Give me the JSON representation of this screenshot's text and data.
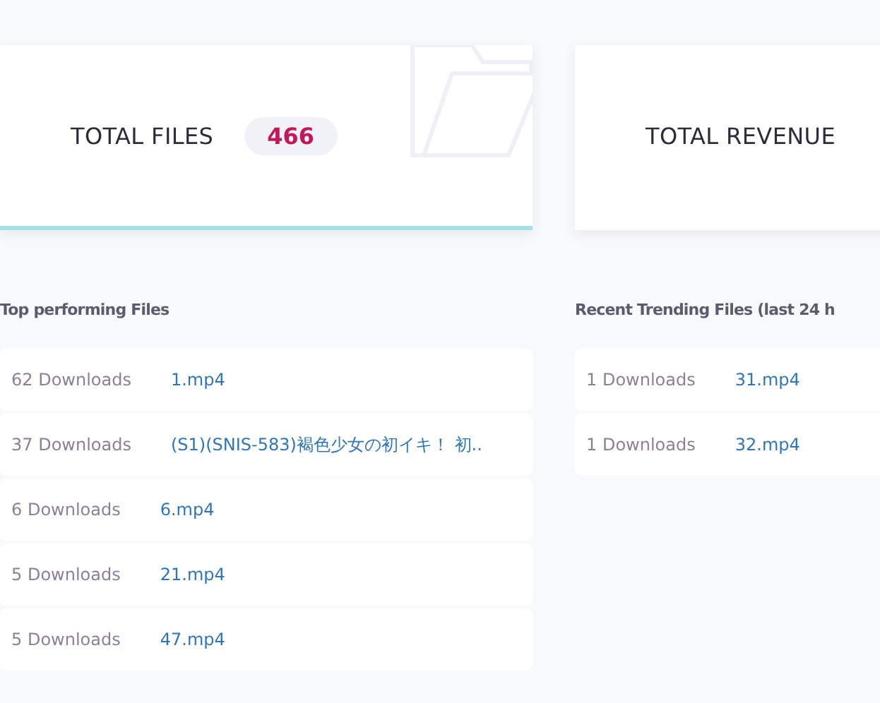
{
  "stat_cards": [
    {
      "label": "TOTAL FILES",
      "value": "466",
      "highlighted": true
    },
    {
      "label": "TOTAL REVENUE",
      "highlighted": false
    }
  ],
  "sections": [
    {
      "title": "Top performing Files",
      "rows": [
        {
          "downloads": "62 Downloads",
          "file": "1.mp4"
        },
        {
          "downloads": "37 Downloads",
          "file": "(S1)(SNIS-583)褐色少女の初イキ！ 初.."
        },
        {
          "downloads": "6 Downloads",
          "file": "6.mp4"
        },
        {
          "downloads": "5 Downloads",
          "file": "21.mp4"
        },
        {
          "downloads": "5 Downloads",
          "file": "47.mp4"
        }
      ]
    },
    {
      "title": "Recent Trending Files (last 24 h",
      "rows": [
        {
          "downloads": "1 Downloads",
          "file": "31.mp4"
        },
        {
          "downloads": "1 Downloads",
          "file": "32.mp4"
        }
      ]
    }
  ]
}
